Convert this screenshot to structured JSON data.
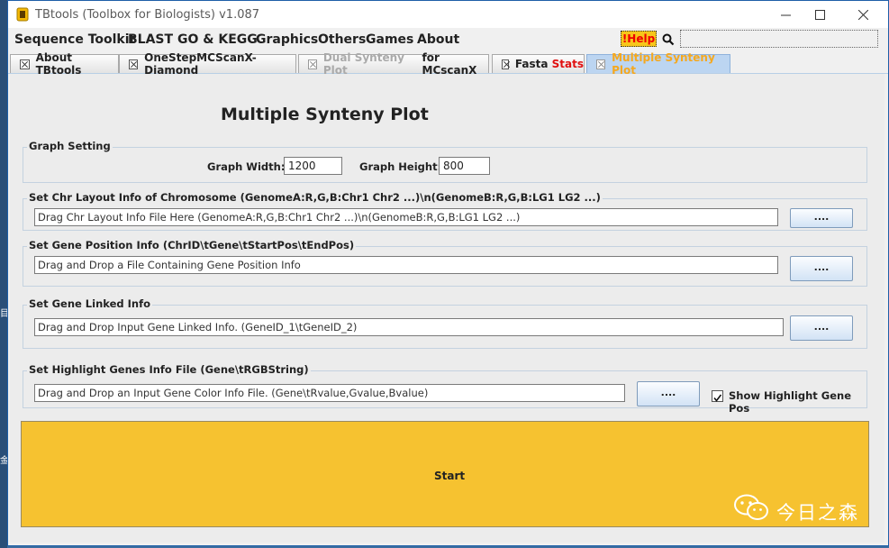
{
  "window": {
    "title": "TBtools (Toolbox for Biologists) v1.087"
  },
  "menu": {
    "items": [
      "Sequence Toolkit",
      "BLAST",
      "GO & KEGG",
      "Graphics",
      "Others",
      "Games",
      "About"
    ],
    "help_label": "!Help"
  },
  "tabs": [
    {
      "label": "About TBtools",
      "state": "normal"
    },
    {
      "label": "OneStepMCScanX-Diamond",
      "state": "normal"
    },
    {
      "label_a": "Dual Synteny Plot",
      "label_b": "for MCscanX",
      "state": "dim"
    },
    {
      "label_a": "Fasta",
      "label_b": "Stats",
      "state": "normal"
    },
    {
      "label": "Multiple Synteny Plot",
      "state": "active"
    }
  ],
  "main": {
    "heading": "Multiple Synteny Plot",
    "graph_setting": {
      "title": "Graph Setting",
      "width_label": "Graph Width:",
      "width_value": "1200",
      "height_label": "Graph Height:",
      "height_value": "800"
    },
    "chr_layout": {
      "title": "Set Chr Layout Info of Chromosome (GenomeA:R,G,B:Chr1 Chr2 ...)\\n(GenomeB:R,G,B:LG1 LG2 ...)",
      "value": "Drag Chr Layout Info File Here (GenomeA:R,G,B:Chr1 Chr2 ...)\\n(GenomeB:R,G,B:LG1 LG2 ...)",
      "button": "...."
    },
    "gene_position": {
      "title": "Set Gene Position Info (ChrID\\tGene\\tStartPos\\tEndPos)",
      "value": "Drag and Drop a File Containing Gene Position Info",
      "button": "...."
    },
    "gene_linked": {
      "title": "Set Gene Linked Info",
      "value": "Drag and Drop Input Gene Linked Info. (GeneID_1\\tGeneID_2)",
      "button": "...."
    },
    "highlight": {
      "title": "Set Highlight Genes Info File (Gene\\tRGBString)",
      "value": "Drag and Drop an Input Gene Color Info File. (Gene\\tRvalue,Gvalue,Bvalue)",
      "button": "....",
      "checkbox_label": "Show Highlight Gene Pos",
      "checked": true
    },
    "start_label": "Start"
  },
  "watermark": {
    "text": "今日之森"
  },
  "desktop": {
    "glyphs": [
      "目",
      "金"
    ]
  },
  "colors": {
    "start_bg": "#f6c230",
    "active_tab_text": "#f5a81f",
    "help_bg": "#f7c61a",
    "accent_red": "#e01010"
  }
}
